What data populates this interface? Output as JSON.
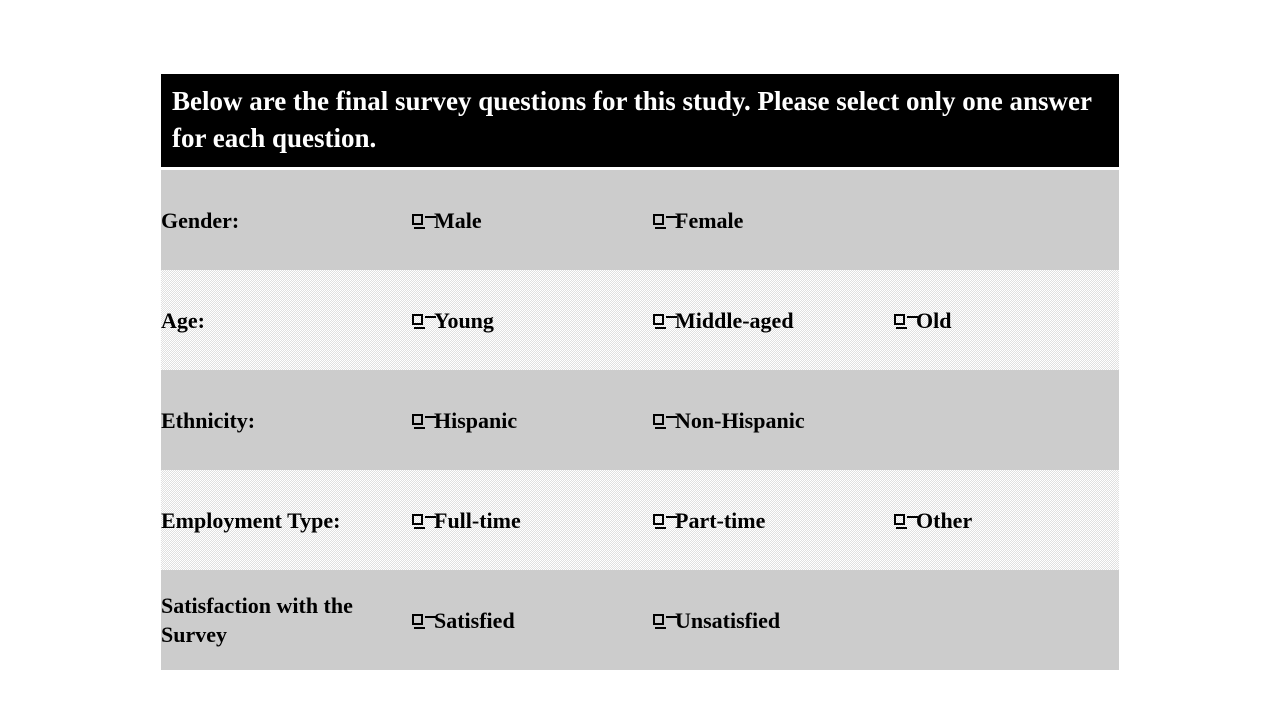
{
  "header": {
    "text": "Below are the final survey questions for this study. Please select only one answer for each question.",
    "background_color": "#000000",
    "text_color": "#ffffff"
  },
  "checkbox_icon": "empty-checkbox",
  "colors": {
    "row_dark": "#cccccc",
    "row_light": "#e0e0e0",
    "page_background": "#ffffff",
    "text": "#000000"
  },
  "questions": [
    {
      "label": "Gender:",
      "shading": "dark",
      "options": [
        "Male",
        "Female"
      ]
    },
    {
      "label": "Age:",
      "shading": "light",
      "options": [
        "Young",
        "Middle-aged",
        "Old"
      ]
    },
    {
      "label": "Ethnicity:",
      "shading": "dark",
      "options": [
        "Hispanic",
        "Non-Hispanic"
      ]
    },
    {
      "label": "Employment Type:",
      "shading": "light",
      "options": [
        "Full-time",
        "Part-time",
        "Other"
      ]
    },
    {
      "label": "Satisfaction with the Survey",
      "shading": "dark",
      "options": [
        "Satisfied",
        "Unsatisfied"
      ]
    }
  ]
}
